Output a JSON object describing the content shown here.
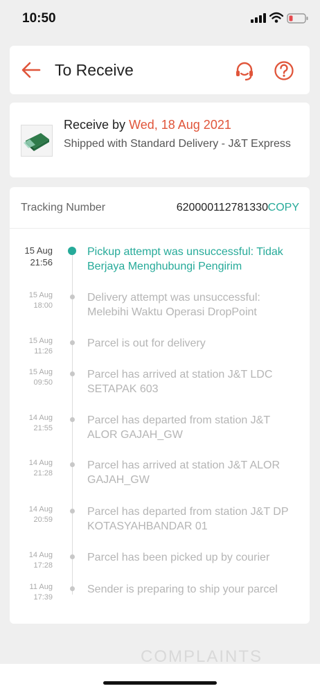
{
  "status_bar": {
    "time": "10:50"
  },
  "header": {
    "title": "To Receive",
    "back_icon": "arrow-left-icon",
    "support_icon": "headset-icon",
    "help_icon": "question-icon"
  },
  "delivery": {
    "receive_prefix": "Receive by",
    "receive_date": "Wed, 18 Aug 2021",
    "shipped_with": "Shipped with Standard Delivery  - J&T Express"
  },
  "tracking": {
    "label": "Tracking Number",
    "number": "620000112781330",
    "copy_label": "COPY",
    "events": [
      {
        "date": "15 Aug",
        "time": "21:56",
        "text": "Pickup attempt was unsuccessful: Tidak Berjaya Menghubungi Pengirim"
      },
      {
        "date": "15 Aug",
        "time": "18:00",
        "text": "Delivery attempt was unsuccessful: Melebihi Waktu Operasi DropPoint"
      },
      {
        "date": "15 Aug",
        "time": "11:26",
        "text": "Parcel is out for delivery"
      },
      {
        "date": "15 Aug",
        "time": "09:50",
        "text": "Parcel has arrived at station J&T LDC SETAPAK 603"
      },
      {
        "date": "14 Aug",
        "time": "21:55",
        "text": "Parcel has departed from station J&T ALOR GAJAH_GW"
      },
      {
        "date": "14 Aug",
        "time": "21:28",
        "text": "Parcel has arrived at station J&T ALOR GAJAH_GW"
      },
      {
        "date": "14 Aug",
        "time": "20:59",
        "text": "Parcel has departed from station J&T DP KOTASYAHBANDAR 01"
      },
      {
        "date": "14 Aug",
        "time": "17:28",
        "text": "Parcel has been picked up by courier"
      },
      {
        "date": "11 Aug",
        "time": "17:39",
        "text": "Sender is preparing to ship your parcel"
      }
    ]
  },
  "watermark": "COMPLAINTS",
  "colors": {
    "accent": "#e0553a",
    "teal": "#26aa99"
  }
}
